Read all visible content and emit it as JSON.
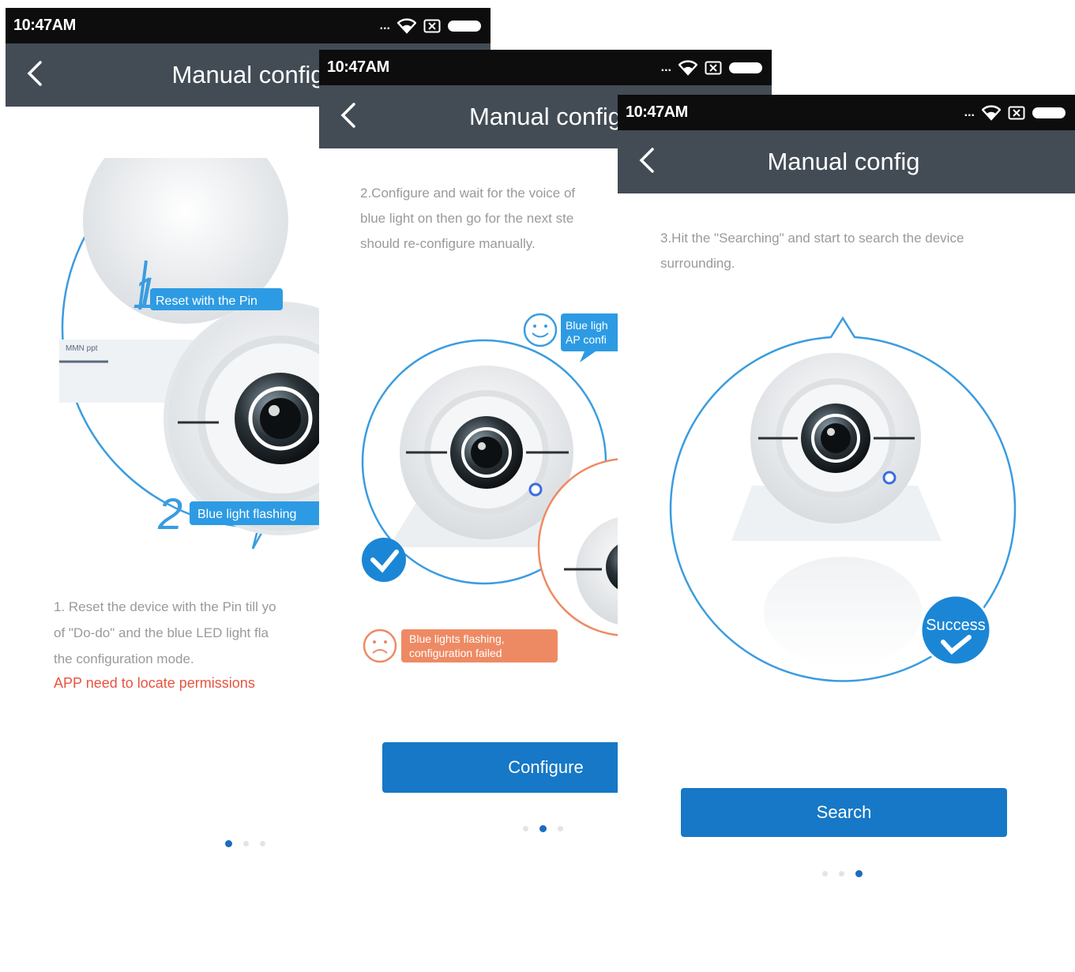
{
  "screens": [
    {
      "status": {
        "time": "10:47AM",
        "dots": "..."
      },
      "header": {
        "title": "Manual config"
      },
      "illustration": {
        "label1_num": "1",
        "label1": "Reset with the Pin",
        "label2_num": "2",
        "label2": "Blue light flashing",
        "small_text": "MMN ppt"
      },
      "instruction": "1. Reset the device with the Pin till yo of \"Do-do\" and the blue LED light fla the configuration mode.",
      "instruction_lines": [
        "1. Reset the device with the Pin till yo",
        "of \"Do-do\" and the blue LED light fla",
        "the configuration mode."
      ],
      "warning": "APP need to locate permissions",
      "pager": {
        "count": 3,
        "active": 0
      }
    },
    {
      "status": {
        "time": "10:47AM",
        "dots": "..."
      },
      "header": {
        "title": "Manual config"
      },
      "instruction_lines": [
        "2.Configure and wait for the voice of",
        "blue light on then go for the next ste",
        "should re-configure manually."
      ],
      "illustration": {
        "success_bubble_l1": "Blue ligh",
        "success_bubble_l2": "AP confi",
        "fail_bubble_l1": "Blue lights flashing,",
        "fail_bubble_l2": "configuration failed"
      },
      "button": {
        "label": "Configure"
      },
      "pager": {
        "count": 3,
        "active": 1
      }
    },
    {
      "status": {
        "time": "10:47AM",
        "dots": "..."
      },
      "header": {
        "title": "Manual config"
      },
      "instruction_lines": [
        "3.Hit the \"Searching\" and start to search the device",
        "surrounding."
      ],
      "illustration": {
        "badge": "Success"
      },
      "button": {
        "label": "Search"
      },
      "pager": {
        "count": 3,
        "active": 2
      }
    }
  ],
  "colors": {
    "statusbar": "#0d0d0d",
    "appbar": "#434c55",
    "primary": "#1678c6",
    "label_blue": "#2d9be3",
    "fail_orange": "#ee8a63",
    "warning": "#e8533f",
    "instruction_text": "#9a9a9a"
  },
  "icons": [
    "back-arrow-icon",
    "wifi-icon",
    "sim-icon",
    "battery-icon",
    "smile-icon",
    "sad-icon",
    "checkmark-icon"
  ]
}
